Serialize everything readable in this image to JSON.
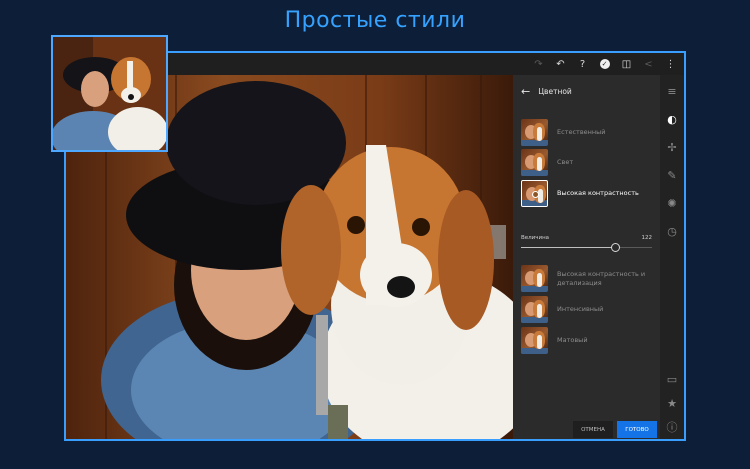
{
  "headline": "Простые стили",
  "toolbar": {
    "icons": [
      "redo-icon",
      "undo-icon",
      "help-icon",
      "check-icon",
      "compare-icon",
      "share-icon",
      "more-icon"
    ]
  },
  "panel": {
    "title": "Цветной",
    "presets": [
      {
        "label": "Естественный",
        "selected": false
      },
      {
        "label": "Свет",
        "selected": false
      },
      {
        "label": "Высокая контрастность",
        "selected": true
      },
      {
        "label": "Высокая контрастность и детализация",
        "selected": false
      },
      {
        "label": "Интенсивный",
        "selected": false
      },
      {
        "label": "Матовый",
        "selected": false
      }
    ],
    "amount": {
      "label": "Величина",
      "value": "122",
      "fraction": 0.72
    }
  },
  "buttons": {
    "cancel": "ОТМЕНА",
    "done": "ГОТОВО"
  },
  "rail_icons": [
    "sliders-icon",
    "presets-icon",
    "healing-icon",
    "brush-icon",
    "radial-icon",
    "history-icon",
    "comment-icon",
    "star-icon",
    "info-icon"
  ],
  "colors": {
    "accent": "#1473e6",
    "headline": "#35a2ff",
    "frame_border": "#3a9eff",
    "background": "#0d1f38"
  }
}
